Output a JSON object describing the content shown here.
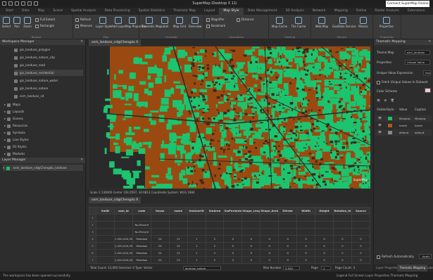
{
  "window": {
    "title": "SuperMap iDesktop X 11i",
    "user_badge": "Connect SuperMap Online..."
  },
  "ribbon": {
    "tabs": [
      "Start",
      "Data",
      "Map",
      "Scene",
      "Spatial Analysis",
      "Data Processing",
      "Spatial Statistics",
      "Thematic Map",
      "Layout",
      "Map Style",
      "Data Management",
      "3D Analysis",
      "Network",
      "Mapping",
      "Online",
      "Raster Analysis",
      "Extensions",
      "Help"
    ],
    "active_tab": "Map Style",
    "buttons": {
      "select": "Select",
      "pan": "Pan",
      "zoom": "Zoom",
      "full_extent": "Full Extent",
      "rect_zoom": "Rectangle",
      "refresh": "Refresh",
      "measure": "Measure",
      "distance": "Distance",
      "layer_style": "Layer Style",
      "add_layer": "Add Layer",
      "map_properties": "Map Properties",
      "thematic": "Thematic Map",
      "label": "Label",
      "map_grid": "Map Grid",
      "overview": "Overview",
      "map_cache": "Map Cache",
      "magnifier": "Magnifier",
      "bookmark": "Bookmark",
      "tile_cache": "Tile Cache",
      "web_map": "Web Map",
      "geo_data_service": "GeoData Service",
      "mosaic": "Mosaic",
      "properties": "Properties"
    },
    "groups": [
      "Browse",
      "Map",
      "Thematic",
      "Operations",
      "Caching",
      "Service",
      "Properties"
    ]
  },
  "workspace_manager": {
    "title": "Workspace Manager",
    "datasets": [
      "gis_landuse_polygon",
      "gis_landuse_nature_city",
      "gis_landuse_road",
      "gis_landuse_residential",
      "gis_landuse_nature_water",
      "gis_landuse_nature",
      "osm_landuse_cd"
    ],
    "nodes": [
      "Maps",
      "Layouts",
      "Scenes",
      "Resources",
      "Symbols",
      "Line Styles",
      "Fill Styles",
      "Modules"
    ]
  },
  "layer_manager": {
    "title": "Layer Manager",
    "layer": "osm_landuse_cd@Chengdu_landuse"
  },
  "map_window": {
    "tab_title": "osm_landuse_cd@Chengdu X",
    "status": "Scale 1:130000  Center 104.0597, 30.6813  Coordinate System: WGS 1984",
    "attribution": "SuperMap"
  },
  "attribute_table": {
    "tab_title": "osm_landuse_cd@Chengdu X",
    "columns": [
      "SmID",
      "osm_id",
      "code",
      "fclass",
      "name",
      "SmUserID",
      "SmArea",
      "SmPerimeter",
      "Shape_Leng",
      "Shape_Area",
      "ZOrder",
      "Width",
      "Height",
      "Relation_Id",
      "Source"
    ],
    "rows": [
      {
        "rn": "1",
        "cells": [
          "",
          "",
          "",
          "",
          "",
          "",
          "",
          "",
          "",
          "",
          "",
          "",
          "",
          "",
          ""
        ]
      },
      {
        "rn": "2",
        "cells": [
          "",
          "",
          "No-Record",
          "",
          "",
          "",
          "",
          "",
          "",
          "",
          "",
          "",
          "",
          "",
          ""
        ]
      },
      {
        "rn": "3",
        "cells": [
          "",
          "",
          "No-Record",
          "",
          "",
          "",
          "",
          "",
          "",
          "",
          "",
          "",
          "",
          "",
          ""
        ]
      },
      {
        "rn": "4",
        "cells": [
          "",
          "1,000,000,000",
          "Meadow",
          "24",
          "13",
          "1",
          "2",
          "0",
          "0",
          "0",
          "0",
          "0",
          "0",
          "0",
          "0"
        ]
      },
      {
        "rn": "5",
        "cells": [
          "",
          "1,000,000,000",
          "Meadow",
          "24",
          "13",
          "1",
          "2",
          "0",
          "0",
          "0",
          "0",
          "0",
          "0",
          "0",
          "0"
        ]
      },
      {
        "rn": "6",
        "cells": [
          "",
          "1,000,000,000",
          "Meadow",
          "24",
          "13",
          "1",
          "2",
          "0",
          "0",
          "0",
          "0",
          "0",
          "0",
          "0",
          "0"
        ]
      },
      {
        "rn": "7",
        "cells": [
          "",
          "1,000,000,000",
          "Meadow",
          "24",
          "13",
          "1",
          "2",
          "0",
          "0",
          "0",
          "0",
          "0",
          "0",
          "0",
          "0"
        ]
      }
    ],
    "status_left": "Total Count: 13,000  Selected: 0  Type: Vector",
    "field_value": "landuse_nature",
    "count_label": "Max Number",
    "count_value": "5,000",
    "page_label": "Page",
    "page_value": "1",
    "page_info": "Page Count: 3"
  },
  "thematic_panel": {
    "title": "Thematic Mapping",
    "theme_map_label": "Theme Map",
    "theme_map_value": "osm_landuse",
    "properties_label": "Properties",
    "properties_value": "Unique Value",
    "expression_label": "Unique Value Expression",
    "expression_value": "fclass",
    "expression_checkbox": "Fetch Unique Values In Dataset",
    "color_scheme_label": "Color Scheme",
    "list_headers": [
      "Visible",
      "Style",
      "Value",
      "Caption"
    ],
    "items": [
      {
        "value": "Meadow",
        "caption": "Meadow",
        "color": "#19c06d"
      },
      {
        "value": "forest",
        "caption": "forest",
        "color": "#b05a18"
      },
      {
        "value": "default",
        "caption": "default",
        "color": "#8a8a8a"
      }
    ],
    "auto_refresh": "Refresh Automatically",
    "apply_button": "Apply",
    "bottom_tabs": [
      "Layer Properties",
      "Thematic Mapping",
      "Label"
    ]
  },
  "status_bar": {
    "left": "The workspace has been opened successfully.",
    "right": "Legend  Full Screen  Layer Properties  Thematic Mapping"
  },
  "colors": {
    "map_fill_primary": "#9a4a10",
    "map_fill_green": "#1cc46f",
    "map_dark": "#2a2a2a",
    "accent": "#3c3c3c"
  }
}
